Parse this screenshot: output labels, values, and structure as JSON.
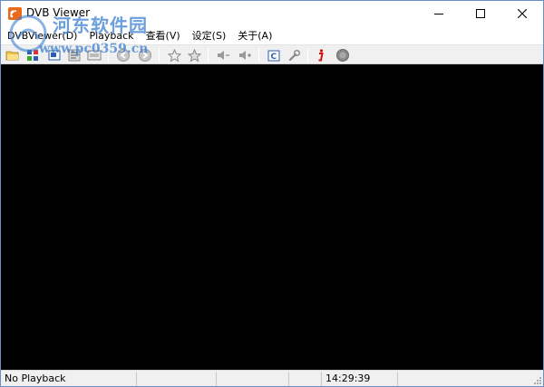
{
  "window": {
    "title": "DVB Viewer"
  },
  "watermark": {
    "line1": "河东软件园",
    "line2": "www.pc0359.cn"
  },
  "menu": {
    "items": [
      "DVBViewer(D)",
      "Playback",
      "查看(V)",
      "设定(S)",
      "关于(A)"
    ]
  },
  "toolbar": {
    "buttons": [
      {
        "icon": "open-folder-icon"
      },
      {
        "icon": "channel-list-icon"
      },
      {
        "icon": "picture-in-picture-icon"
      },
      {
        "icon": "teletext-icon"
      },
      {
        "icon": "epg-icon"
      },
      {
        "icon": "back-icon"
      },
      {
        "icon": "forward-icon"
      },
      {
        "icon": "favorite-star-icon"
      },
      {
        "icon": "favorites-icon"
      },
      {
        "icon": "volume-down-icon"
      },
      {
        "icon": "volume-up-icon"
      },
      {
        "icon": "audio-channel-icon"
      },
      {
        "icon": "settings-wrench-icon"
      },
      {
        "icon": "info-icon"
      },
      {
        "icon": "record-icon"
      }
    ]
  },
  "status": {
    "playback": "No Playback",
    "time": "14:29:39"
  },
  "colors": {
    "video_bg": "#000000",
    "toolbar_bg": "#f0f0f0",
    "accent_red": "#d01010",
    "watermark_blue": "#3b7fd0"
  }
}
